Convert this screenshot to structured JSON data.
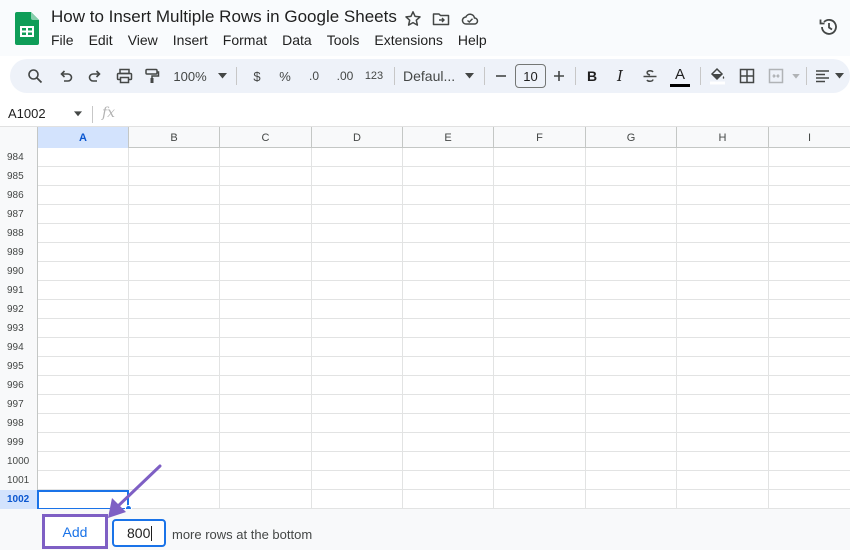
{
  "document": {
    "title": "How to Insert Multiple Rows in Google Sheets",
    "menu": [
      "File",
      "Edit",
      "View",
      "Insert",
      "Format",
      "Data",
      "Tools",
      "Extensions",
      "Help"
    ]
  },
  "toolbar": {
    "zoom": "100%",
    "currency": "$",
    "percent": "%",
    "decrease_decimal": ".0",
    "increase_decimal": ".00",
    "number_format": "123",
    "font": "Defaul...",
    "font_size": "10",
    "bold": "B",
    "italic": "I",
    "text_color": "A"
  },
  "formula_bar": {
    "name_box": "A1002",
    "fx": "fx"
  },
  "grid": {
    "columns": [
      "A",
      "B",
      "C",
      "D",
      "E",
      "F",
      "G",
      "H",
      "I"
    ],
    "rows": [
      "984",
      "985",
      "986",
      "987",
      "988",
      "989",
      "990",
      "991",
      "992",
      "993",
      "994",
      "995",
      "996",
      "997",
      "998",
      "999",
      "1000",
      "1001",
      "1002"
    ],
    "selected_column": "A",
    "selected_row": "1002"
  },
  "add_rows": {
    "button_label": "Add",
    "count": "800",
    "suffix": "more rows at the bottom"
  },
  "colors": {
    "accent": "#1a73e8",
    "annotation": "#7e5fc4",
    "selection": "#d3e3fd"
  }
}
